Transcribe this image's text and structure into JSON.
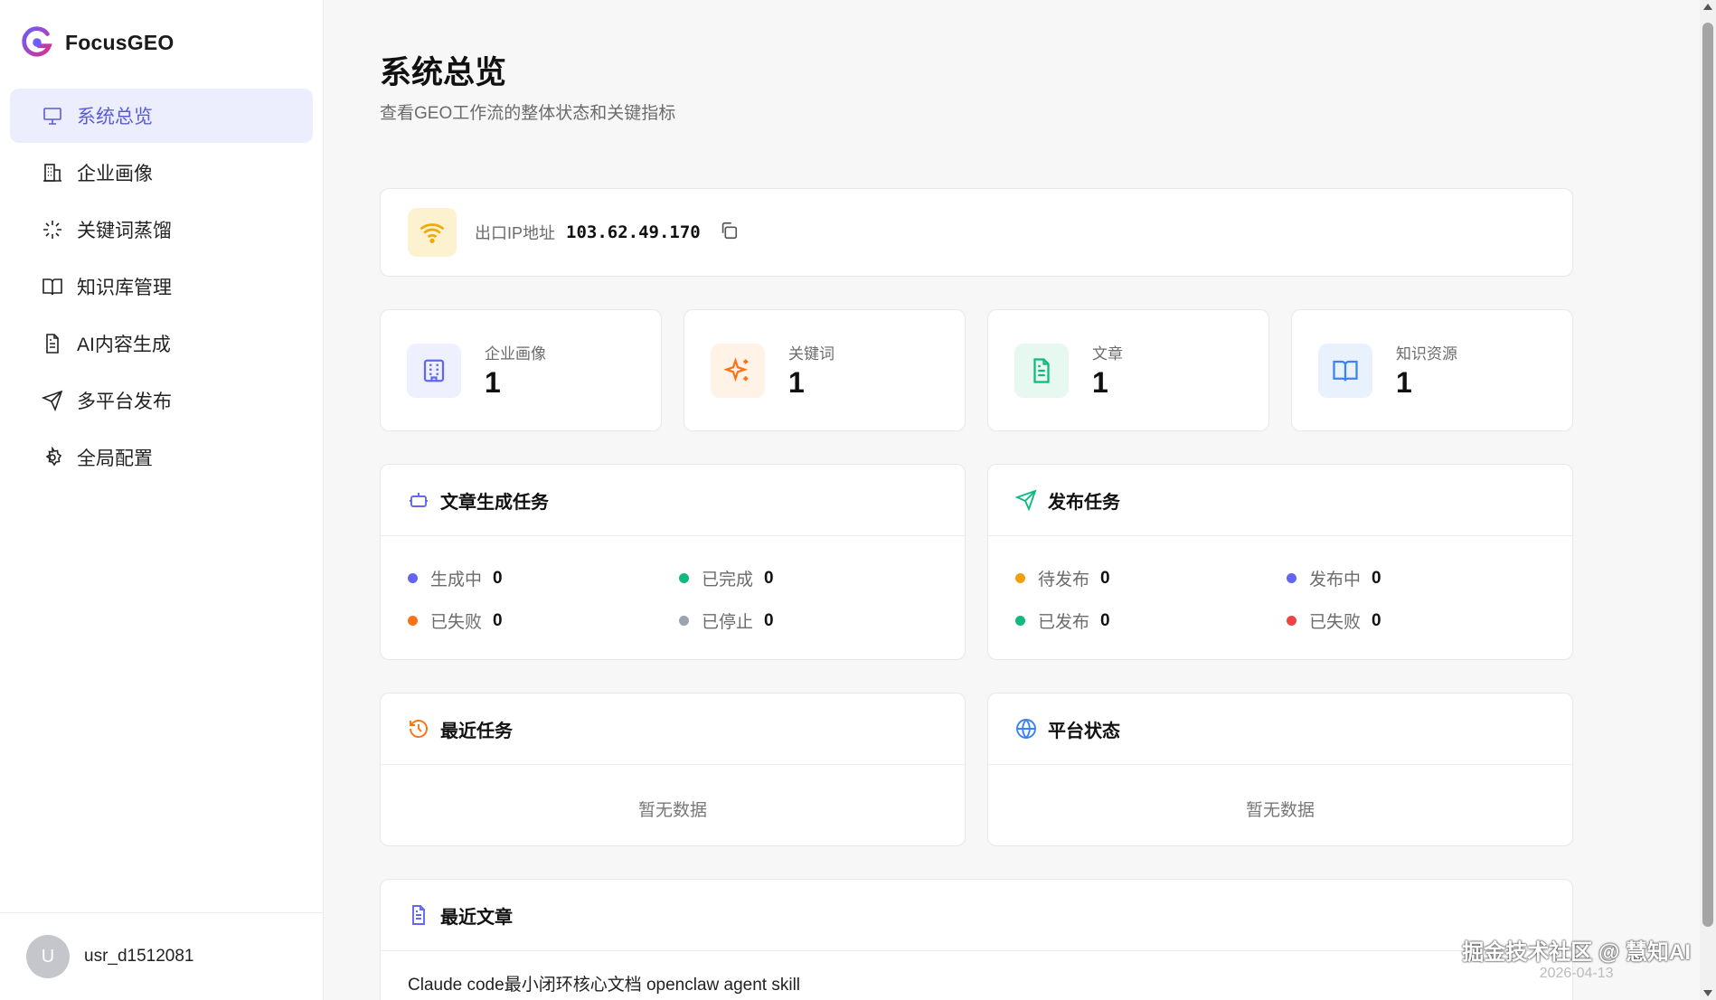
{
  "brand": {
    "name": "FocusGEO"
  },
  "sidebar": {
    "items": [
      {
        "label": "系统总览",
        "icon": "presentation-icon",
        "active": true
      },
      {
        "label": "企业画像",
        "icon": "building-icon"
      },
      {
        "label": "关键词蒸馏",
        "icon": "sparkle-loader-icon"
      },
      {
        "label": "知识库管理",
        "icon": "book-icon"
      },
      {
        "label": "AI内容生成",
        "icon": "document-icon"
      },
      {
        "label": "多平台发布",
        "icon": "send-icon"
      },
      {
        "label": "全局配置",
        "icon": "gear-icon"
      }
    ],
    "user": {
      "avatar_letter": "U",
      "name": "usr_d1512081"
    }
  },
  "page": {
    "title": "系统总览",
    "subtitle": "查看GEO工作流的整体状态和关键指标"
  },
  "ip": {
    "label": "出口IP地址",
    "value": "103.62.49.170"
  },
  "stats": [
    {
      "label": "企业画像",
      "value": "1",
      "color": "#6366f1",
      "bg": "#eef0fd"
    },
    {
      "label": "关键词",
      "value": "1",
      "color": "#f97316",
      "bg": "#fff3e8"
    },
    {
      "label": "文章",
      "value": "1",
      "color": "#10b981",
      "bg": "#e7f8f1"
    },
    {
      "label": "知识资源",
      "value": "1",
      "color": "#3b82f6",
      "bg": "#e9f1fd"
    }
  ],
  "gen_tasks": {
    "title": "文章生成任务",
    "items": [
      {
        "label": "生成中",
        "value": "0",
        "color": "#6366f1"
      },
      {
        "label": "已完成",
        "value": "0",
        "color": "#10b981"
      },
      {
        "label": "已失败",
        "value": "0",
        "color": "#f97316"
      },
      {
        "label": "已停止",
        "value": "0",
        "color": "#9ca3af"
      }
    ]
  },
  "pub_tasks": {
    "title": "发布任务",
    "items": [
      {
        "label": "待发布",
        "value": "0",
        "color": "#f59e0b"
      },
      {
        "label": "发布中",
        "value": "0",
        "color": "#6366f1"
      },
      {
        "label": "已发布",
        "value": "0",
        "color": "#10b981"
      },
      {
        "label": "已失败",
        "value": "0",
        "color": "#ef4444"
      }
    ]
  },
  "recent_tasks": {
    "title": "最近任务",
    "empty": "暂无数据"
  },
  "platform_status": {
    "title": "平台状态",
    "empty": "暂无数据"
  },
  "recent_articles": {
    "title": "最近文章",
    "items": [
      "Claude code最小闭环核心文档 openclaw agent skill"
    ]
  },
  "watermark": {
    "text": "掘金技术社区 @ 慧知AI",
    "date": "2026-04-13"
  }
}
